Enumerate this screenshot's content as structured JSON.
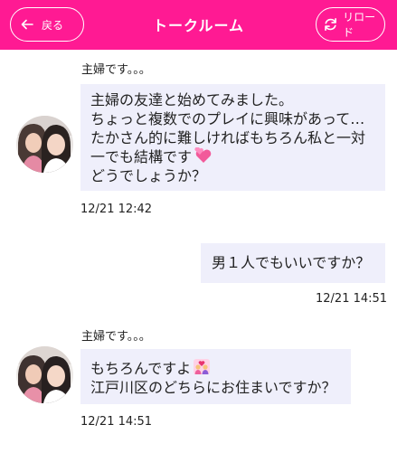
{
  "header": {
    "back_label": "戻る",
    "title": "トークルーム",
    "reload_label": "リロード",
    "brand_color": "#ff1a93"
  },
  "messages": [
    {
      "direction": "incoming",
      "sender": "主婦です。。。",
      "lines": [
        "主婦の友達と始めてみました。",
        "ちょっと複数でのプレイに興味があって…",
        "たかさん的に難しければもちろん私と一対",
        "一でも結構です",
        "どうでしょうか？"
      ],
      "emoji": "two-hearts",
      "time": "12/21 12:42"
    },
    {
      "direction": "outgoing",
      "text": "男１人でもいいですか？",
      "time": "12/21 14:51"
    },
    {
      "direction": "incoming",
      "sender": "主婦です。。。",
      "lines": [
        "もちろんですよ",
        "江戸川区のどちらにお住まいですか？"
      ],
      "emoji": "couple-with-heart",
      "time": "12/21 14:51"
    }
  ],
  "colors": {
    "bubble_bg": "#efeffb"
  }
}
